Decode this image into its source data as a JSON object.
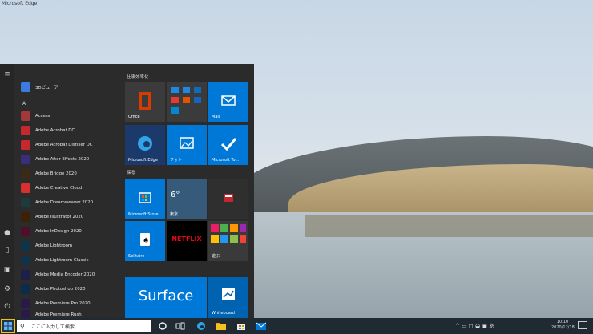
{
  "window": {
    "title": "Microsoft Edge"
  },
  "start_menu": {
    "apps": [
      {
        "label": "3Dビューアー",
        "color": "#3b7be0"
      },
      {
        "letter": "A"
      },
      {
        "label": "Access",
        "color": "#a4373a"
      },
      {
        "label": "Adobe Acrobat DC",
        "color": "#c7282e"
      },
      {
        "label": "Adobe Acrobat Distiller DC",
        "color": "#c7282e"
      },
      {
        "label": "Adobe After Effects 2020",
        "color": "#3a2d7a"
      },
      {
        "label": "Adobe Bridge 2020",
        "color": "#3b2a14"
      },
      {
        "label": "Adobe Creative Cloud",
        "color": "#d8302f"
      },
      {
        "label": "Adobe Dreamweaver 2020",
        "color": "#1d3b3a"
      },
      {
        "label": "Adobe Illustrator 2020",
        "color": "#3b2106"
      },
      {
        "label": "Adobe InDesign 2020",
        "color": "#4d0f2a"
      },
      {
        "label": "Adobe Lightroom",
        "color": "#0f3349"
      },
      {
        "label": "Adobe Lightroom Classic",
        "color": "#0f3349"
      },
      {
        "label": "Adobe Media Encoder 2020",
        "color": "#1e1e4a"
      },
      {
        "label": "Adobe Photoshop 2020",
        "color": "#0d2b4a"
      },
      {
        "label": "Adobe Premiere Pro 2020",
        "color": "#2a1a4a"
      },
      {
        "label": "Adobe Premiere Rush",
        "color": "#2a1a4a"
      }
    ],
    "groups": [
      "仕事効率化",
      "探る"
    ],
    "tiles": {
      "office": "Office",
      "mail": "Mail",
      "edge": "Microsoft Edge",
      "photos": "フォト",
      "todo": "Microsoft To...",
      "store": "Microsoft Store",
      "weather_temp": "6°",
      "weather_city": "東京",
      "solitaire": "Solitaire",
      "netflix": "NETFLIX",
      "play": "遊ぶ",
      "surface": "Surface",
      "whiteboard": "Whiteboard"
    }
  },
  "taskbar": {
    "search_placeholder": "ここに入力して検索",
    "clock_time": "10:10",
    "clock_date": "2020/12/18",
    "tray_text": "^ ▭ ◻ ◒ ▣ あ"
  },
  "colors": {
    "accent_blue": "#0078d7",
    "taskbar": "#1f2a33",
    "start_bg": "#2b2b2b",
    "highlight": "#f0c400"
  }
}
